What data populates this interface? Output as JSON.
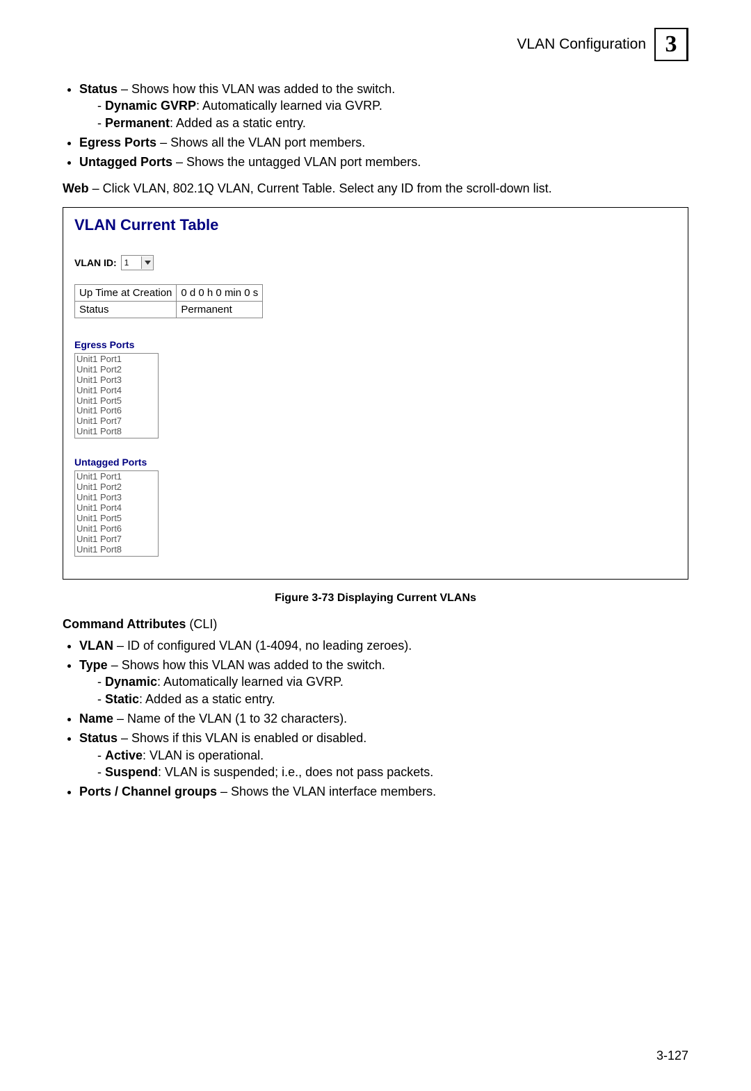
{
  "header": {
    "title": "VLAN Configuration",
    "chapter": "3"
  },
  "top_bullets": {
    "status_term": "Status",
    "status_sep": " – ",
    "status_desc": "Shows how this VLAN was added to the switch.",
    "dyn_gvrp_term": "Dynamic GVRP",
    "dyn_gvrp_desc": ": Automatically learned via GVRP.",
    "permanent_term": "Permanent",
    "permanent_desc": ": Added as a static entry.",
    "egress_term": "Egress Ports",
    "egress_sep": " – ",
    "egress_desc": "Shows all the VLAN port members.",
    "untagged_term": "Untagged Ports",
    "untagged_sep": " – ",
    "untagged_desc": "Shows the untagged VLAN port members."
  },
  "web_line": {
    "lead": "Web",
    "rest": " – Click VLAN, 802.1Q VLAN, Current Table. Select any ID from the scroll-down list."
  },
  "panel": {
    "title": "VLAN Current Table",
    "vlan_id_label": "VLAN ID:",
    "vlan_id_value": "1",
    "info_row1_k": "Up Time at Creation",
    "info_row1_v": "0 d 0 h 0 min 0 s",
    "info_row2_k": "Status",
    "info_row2_v": "Permanent",
    "egress_label": "Egress Ports",
    "egress_ports": [
      "Unit1 Port1",
      "Unit1 Port2",
      "Unit1 Port3",
      "Unit1 Port4",
      "Unit1 Port5",
      "Unit1 Port6",
      "Unit1 Port7",
      "Unit1 Port8"
    ],
    "untagged_label": "Untagged Ports",
    "untagged_ports": [
      "Unit1 Port1",
      "Unit1 Port2",
      "Unit1 Port3",
      "Unit1 Port4",
      "Unit1 Port5",
      "Unit1 Port6",
      "Unit1 Port7",
      "Unit1 Port8"
    ]
  },
  "figure_caption": "Figure 3-73  Displaying Current VLANs",
  "cmd_attr": {
    "lead": "Command Attributes",
    "paren": " (CLI)"
  },
  "cli_bullets": {
    "vlan_term": "VLAN",
    "vlan_desc": " – ID of configured VLAN (1-4094, no leading zeroes).",
    "type_term": "Type",
    "type_desc": " – Shows how this VLAN was added to the switch.",
    "dyn_term": "Dynamic",
    "dyn_desc": ": Automatically learned via GVRP.",
    "static_term": "Static",
    "static_desc": ": Added as a static entry.",
    "name_term": "Name",
    "name_desc": " – Name of the VLAN (1 to 32 characters).",
    "status_term": "Status",
    "status_desc": " – Shows if this VLAN is enabled or disabled.",
    "active_term": "Active",
    "active_desc": ": VLAN is operational.",
    "suspend_term": "Suspend",
    "suspend_desc": ": VLAN is suspended; i.e., does not pass packets.",
    "ports_term": "Ports / Channel groups",
    "ports_desc": " – Shows the VLAN interface members."
  },
  "page_number": "3-127"
}
